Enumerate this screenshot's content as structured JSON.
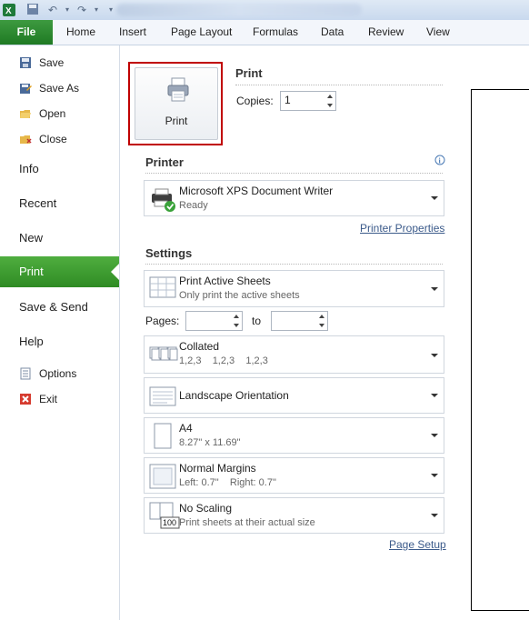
{
  "ribbon": {
    "file_tab": "File",
    "tabs": [
      "Home",
      "Insert",
      "Page Layout",
      "Formulas",
      "Data",
      "Review",
      "View"
    ]
  },
  "nav": {
    "save": "Save",
    "save_as": "Save As",
    "open": "Open",
    "close": "Close",
    "info": "Info",
    "recent": "Recent",
    "new": "New",
    "print": "Print",
    "save_send": "Save & Send",
    "help": "Help",
    "options": "Options",
    "exit": "Exit"
  },
  "print": {
    "section_title": "Print",
    "button_label": "Print",
    "copies_label": "Copies:",
    "copies_value": "1"
  },
  "printer": {
    "section_title": "Printer",
    "name": "Microsoft XPS Document Writer",
    "status": "Ready",
    "properties_link": "Printer Properties"
  },
  "settings": {
    "section_title": "Settings",
    "sheets": {
      "title": "Print Active Sheets",
      "sub": "Only print the active sheets"
    },
    "pages_label": "Pages:",
    "pages_to": "to",
    "pages_from_value": "",
    "pages_to_value": "",
    "collated": {
      "title": "Collated",
      "sub": "1,2,3    1,2,3    1,2,3"
    },
    "orientation": {
      "title": "Landscape Orientation"
    },
    "paper": {
      "title": "A4",
      "sub": "8.27\" x 11.69\""
    },
    "margins": {
      "title": "Normal Margins",
      "sub": "Left: 0.7\"    Right: 0.7\""
    },
    "scaling": {
      "title": "No Scaling",
      "sub": "Print sheets at their actual size",
      "icon_text": "100"
    },
    "page_setup_link": "Page Setup"
  },
  "colors": {
    "file_tab_green": "#2a8a2d",
    "nav_selected_green": "#3f9d33",
    "highlight_red": "#c00000",
    "link_blue": "#3b5a8a"
  }
}
